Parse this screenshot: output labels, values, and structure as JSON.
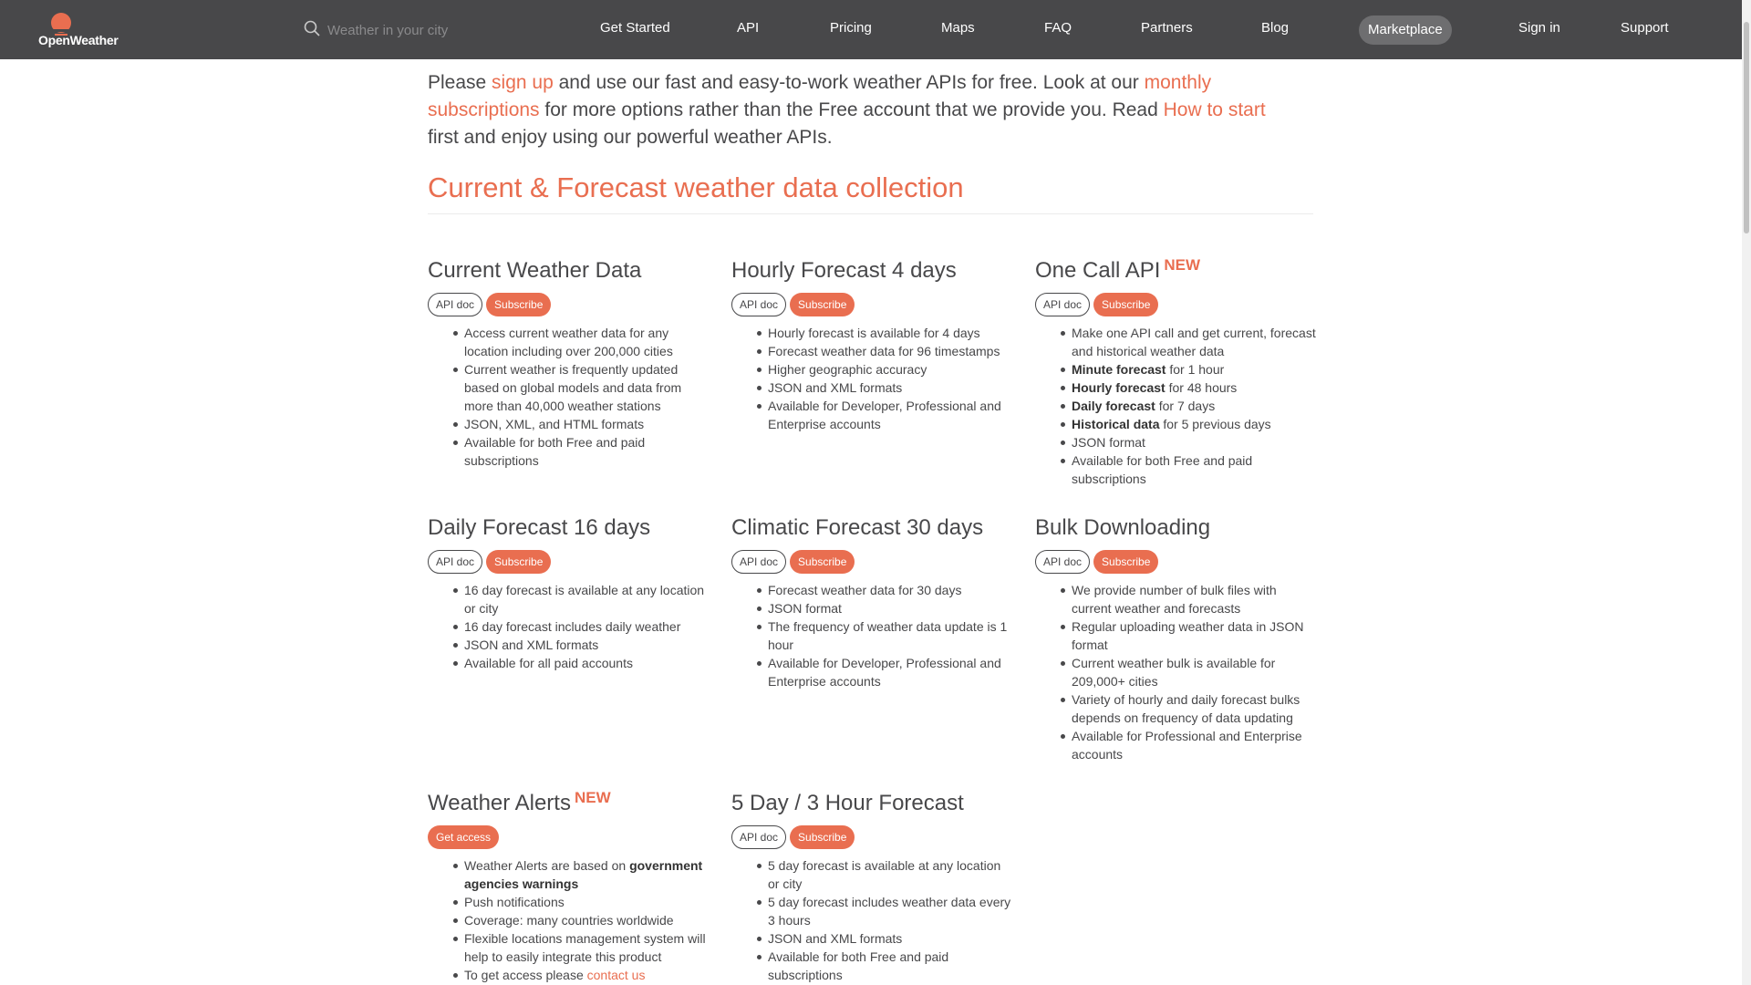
{
  "header": {
    "logo_text": "OpenWeather",
    "search_placeholder": "Weather in your city",
    "nav": [
      "Get Started",
      "API",
      "Pricing",
      "Maps",
      "FAQ",
      "Partners",
      "Blog"
    ],
    "marketplace": "Marketplace",
    "sign_in": "Sign in",
    "support": "Support"
  },
  "intro": {
    "t1": "Please ",
    "link1": "sign up",
    "t2": " and use our fast and easy-to-work weather APIs for free. Look at our ",
    "link2": "monthly subscriptions",
    "t3": " for more options rather than the Free account that we provide you. Read ",
    "link3": "How to start",
    "t4": " first and enjoy using our powerful weather APIs."
  },
  "section_title": "Current & Forecast weather data collection",
  "labels": {
    "api_doc": "API doc",
    "subscribe": "Subscribe",
    "get_access": "Get access",
    "new": "NEW"
  },
  "cards": [
    {
      "title": "Current Weather Data",
      "items": [
        "Access current weather data for any location including over 200,000 cities",
        "Current weather is frequently updated based on global models and data from more than 40,000 weather stations",
        "JSON, XML, and HTML formats",
        "Available for both Free and paid subscriptions"
      ]
    },
    {
      "title": "Hourly Forecast 4 days",
      "items": [
        "Hourly forecast is available for 4 days",
        "Forecast weather data for 96 timestamps",
        "Higher geographic accuracy",
        "JSON and XML formats",
        "Available for Developer, Professional and Enterprise accounts"
      ]
    },
    {
      "title": "One Call API",
      "items": [
        {
          "text": "Make one API call and get current, forecast and historical weather data"
        },
        {
          "bold": "Minute forecast",
          "text": " for 1 hour"
        },
        {
          "bold": "Hourly forecast",
          "text": " for 48 hours"
        },
        {
          "bold": "Daily forecast",
          "text": " for 7 days"
        },
        {
          "bold": "Historical data",
          "text": " for 5 previous days"
        },
        {
          "text": "JSON format"
        },
        {
          "text": "Available for both Free and paid subscriptions"
        }
      ]
    },
    {
      "title": "Daily Forecast 16 days",
      "items": [
        "16 day forecast is available at any location or city",
        "16 day forecast includes daily weather",
        "JSON and XML formats",
        "Available for all paid accounts"
      ]
    },
    {
      "title": "Climatic Forecast 30 days",
      "items": [
        "Forecast weather data for 30 days",
        "JSON format",
        "The frequency of weather data update is 1 hour",
        "Available for Developer, Professional and Enterprise accounts"
      ]
    },
    {
      "title": "Bulk Downloading",
      "items": [
        "We provide number of bulk files with current weather and forecasts",
        "Regular uploading weather data in JSON format",
        "Current weather bulk is available for 209,000+ cities",
        "Variety of hourly and daily forecast bulks depends on frequency of data updating",
        "Available for Professional and Enterprise accounts"
      ]
    },
    {
      "title": "Weather Alerts",
      "items": [
        {
          "text": "Weather Alerts are based on ",
          "bold": "government agencies warnings"
        },
        {
          "text": "Push notifications"
        },
        {
          "text": "Coverage: many countries worldwide"
        },
        {
          "text": "Flexible locations management system will help to easily integrate this product"
        },
        {
          "text": "To get access please ",
          "link": "contact us"
        }
      ]
    },
    {
      "title": "5 Day / 3 Hour Forecast",
      "items": [
        "5 day forecast is available at any location or city",
        "5 day forecast includes weather data every 3 hours",
        "JSON and XML formats",
        "Available for both Free and paid subscriptions"
      ]
    }
  ]
}
